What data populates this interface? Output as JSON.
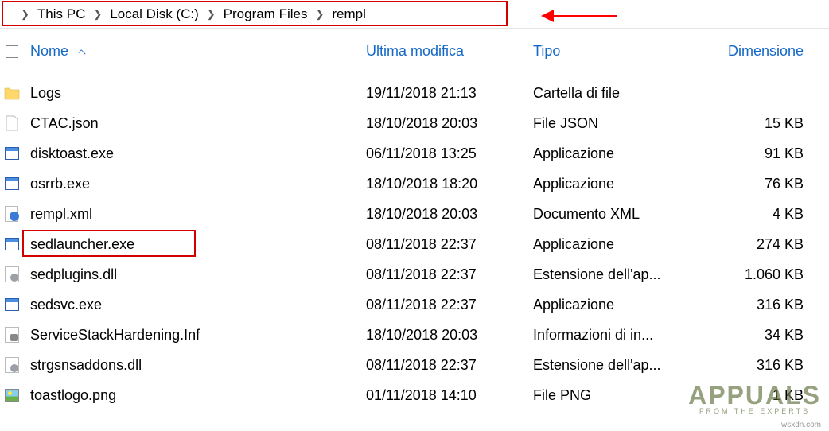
{
  "breadcrumb": {
    "items": [
      "This PC",
      "Local Disk (C:)",
      "Program Files",
      "rempl"
    ]
  },
  "columns": {
    "name": "Nome",
    "modified": "Ultima modifica",
    "type": "Tipo",
    "size": "Dimensione"
  },
  "files": [
    {
      "icon": "folder",
      "name": "Logs",
      "modified": "19/11/2018 21:13",
      "type": "Cartella di file",
      "size": ""
    },
    {
      "icon": "json",
      "name": "CTAC.json",
      "modified": "18/10/2018 20:03",
      "type": "File JSON",
      "size": "15 KB"
    },
    {
      "icon": "exe",
      "name": "disktoast.exe",
      "modified": "06/11/2018 13:25",
      "type": "Applicazione",
      "size": "91 KB"
    },
    {
      "icon": "exe",
      "name": "osrrb.exe",
      "modified": "18/10/2018 18:20",
      "type": "Applicazione",
      "size": "76 KB"
    },
    {
      "icon": "xml",
      "name": "rempl.xml",
      "modified": "18/10/2018 20:03",
      "type": "Documento XML",
      "size": "4 KB"
    },
    {
      "icon": "exe",
      "name": "sedlauncher.exe",
      "modified": "08/11/2018 22:37",
      "type": "Applicazione",
      "size": "274 KB",
      "highlighted": true
    },
    {
      "icon": "dll",
      "name": "sedplugins.dll",
      "modified": "08/11/2018 22:37",
      "type": "Estensione dell'ap...",
      "size": "1.060 KB"
    },
    {
      "icon": "exe",
      "name": "sedsvc.exe",
      "modified": "08/11/2018 22:37",
      "type": "Applicazione",
      "size": "316 KB"
    },
    {
      "icon": "inf",
      "name": "ServiceStackHardening.Inf",
      "modified": "18/10/2018 20:03",
      "type": "Informazioni di in...",
      "size": "34 KB"
    },
    {
      "icon": "dll",
      "name": "strgsnsaddons.dll",
      "modified": "08/11/2018 22:37",
      "type": "Estensione dell'ap...",
      "size": "316 KB"
    },
    {
      "icon": "png",
      "name": "toastlogo.png",
      "modified": "01/11/2018 14:10",
      "type": "File PNG",
      "size": "1 KB"
    }
  ],
  "watermark": {
    "main": "APPUALS",
    "sub": "FROM THE EXPERTS",
    "url": "wsxdn.com"
  }
}
